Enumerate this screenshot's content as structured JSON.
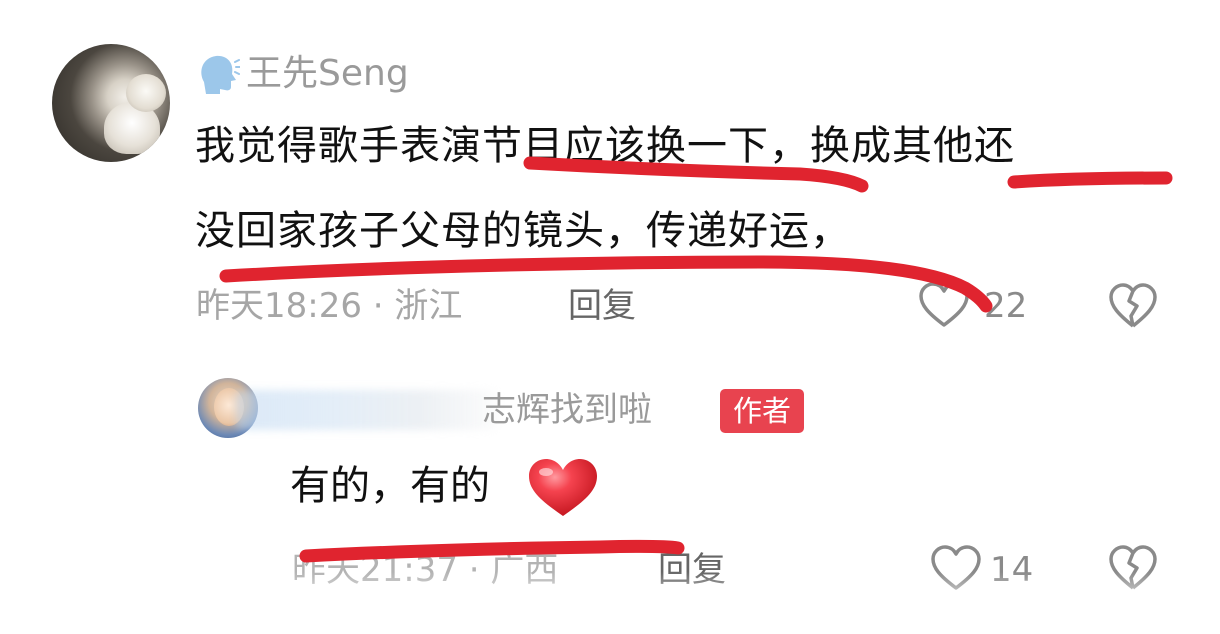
{
  "comment": {
    "username": "王先Seng",
    "text_line1": "我觉得歌手表演节目应该换一下，换成其他还",
    "text_line2": "没回家孩子父母的镜头，传递好运，",
    "meta": "昨天18:26 · 浙江",
    "reply_label": "回复",
    "like_count": "22",
    "icons": {
      "speaker": "speaking-head-icon",
      "like": "heart-outline-icon",
      "dislike": "broken-heart-icon"
    }
  },
  "reply": {
    "username_visible": "志辉找到啦",
    "badge": "作者",
    "text": "有的，有的",
    "meta": "昨天21:37 · 广西",
    "reply_label": "回复",
    "like_count": "14",
    "icons": {
      "emoji": "red-heart-icon",
      "like": "heart-outline-icon",
      "dislike": "broken-heart-icon"
    }
  },
  "colors": {
    "accent_red": "#e8434f",
    "annotation_red": "#e0242f",
    "meta_gray": "#a6a6a6"
  }
}
